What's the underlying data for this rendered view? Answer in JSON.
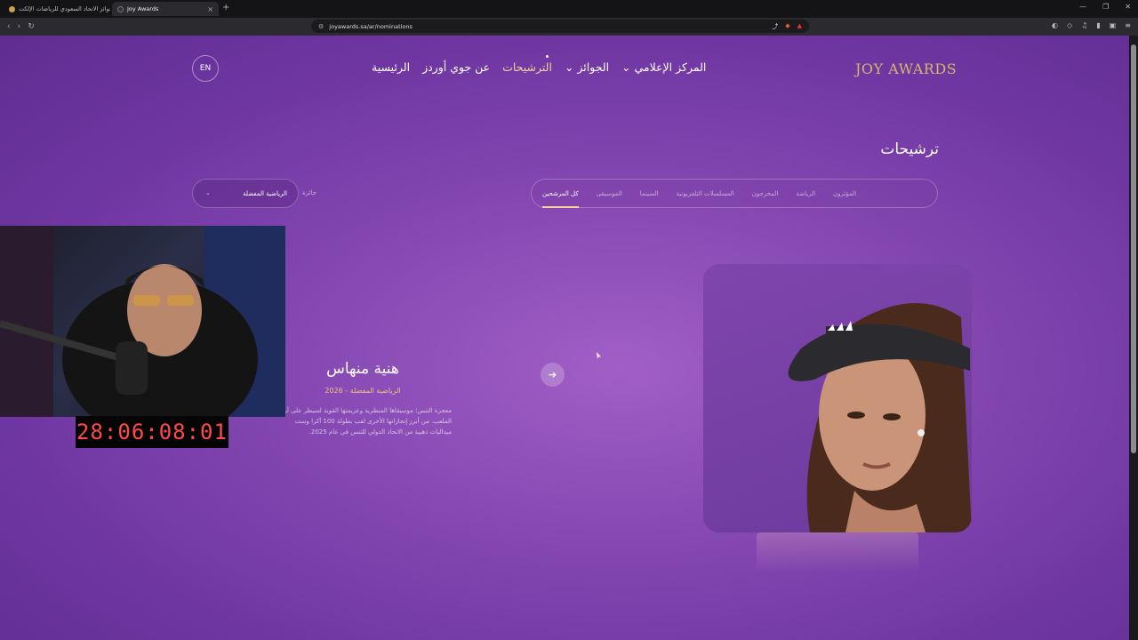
{
  "browser": {
    "tabs": [
      {
        "title": "جوائز الاتحاد السعودي للرياضات الإلكت...",
        "active": false
      },
      {
        "title": "Joy Awards",
        "active": true
      }
    ],
    "url": "joyawards.sa/ar/nominations",
    "controls": {
      "back": "‹",
      "forward": "›",
      "reload": "↻",
      "new_tab": "+",
      "close": "×"
    }
  },
  "site": {
    "logo": "JOY AWARDS",
    "nav": [
      {
        "label": "الرئيسية",
        "active": false
      },
      {
        "label": "عن جوي أوردز",
        "active": false
      },
      {
        "label": "الترشيحات",
        "active": true
      },
      {
        "label": "الجوائز ⌄",
        "active": false
      },
      {
        "label": "المركز الإعلامي ⌄",
        "active": false
      }
    ],
    "lang_button": "EN"
  },
  "page": {
    "title": "ترشيحات",
    "filters": [
      {
        "label": "كل المرشحين",
        "selected": true
      },
      {
        "label": "الموسيقى",
        "selected": false
      },
      {
        "label": "السينما",
        "selected": false
      },
      {
        "label": "المسلسلات التلفزيونية",
        "selected": false
      },
      {
        "label": "المخرجون",
        "selected": false
      },
      {
        "label": "الرياضة",
        "selected": false
      },
      {
        "label": "المؤثرون",
        "selected": false
      }
    ],
    "category_label": "جائزة",
    "category_value": "الرياضية المفضلة",
    "nominee": {
      "name": "هنية منهاس",
      "subtitle": "الرياضية المفضلة - 2026",
      "description": "معجزة التنس؛ موسيقاها المنظرية وعزيمتها القوية لسيطر على أرض الملعب. من أبرز إنجازاتها الأخرى لقب بطولة 100 أكرا وست ميداليات ذهبية من الاتحاد الدولي للتنس في عام 2025."
    },
    "next_icon": "arrow-right-icon"
  },
  "overlay": {
    "timer": "28:06:08:01"
  },
  "colors": {
    "accent_gold": "#d9b46a",
    "bg_purple": "#8a4cb6",
    "timer_red": "#ff4a4a"
  }
}
